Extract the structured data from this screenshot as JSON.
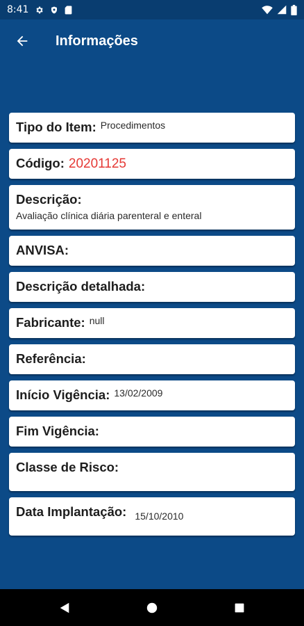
{
  "status_bar": {
    "time": "8:41",
    "icons_left": [
      "gear-icon",
      "shield-icon",
      "sd-card-icon"
    ],
    "icons_right": [
      "wifi-icon",
      "cellular-signal-icon",
      "battery-icon"
    ]
  },
  "app_bar": {
    "title": "Informações",
    "back_icon": "arrow-left-icon"
  },
  "fields": {
    "tipo_label": "Tipo do Item:",
    "tipo_value": "Procedimentos",
    "codigo_label": "Código:",
    "codigo_value": "20201125",
    "descricao_label": "Descrição:",
    "descricao_value": "Avaliação clínica diária parenteral e enteral",
    "anvisa_label": "ANVISA:",
    "detalhada_label": "Descrição detalhada:",
    "fabricante_label": "Fabricante:",
    "fabricante_value": "null",
    "referencia_label": "Referência:",
    "inicio_label": "Início Vigência:",
    "inicio_value": "13/02/2009",
    "fim_label": "Fim Vigência:",
    "classe_label": "Classe de Risco:",
    "data_label": "Data Implantação:",
    "data_value": "15/10/2010"
  },
  "nav_bar": {
    "buttons": [
      "back-triangle-icon",
      "home-circle-icon",
      "recents-square-icon"
    ]
  },
  "colors": {
    "background": "#0c4a87",
    "status_bar": "#093d70",
    "code_value": "#e53935",
    "card": "#ffffff"
  }
}
